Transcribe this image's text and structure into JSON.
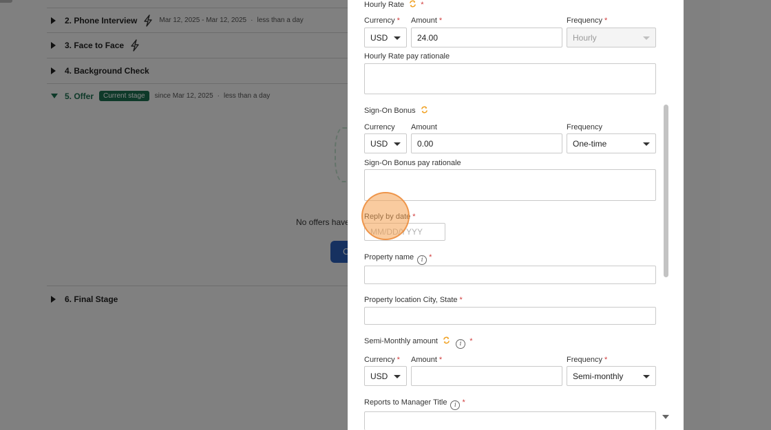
{
  "background": {
    "stages": [
      {
        "title": "2. Phone Interview",
        "dates": "Mar 12, 2025 - Mar 12, 2025",
        "duration": "less than a day"
      },
      {
        "title": "3. Face to Face"
      },
      {
        "title": "4. Background Check"
      },
      {
        "title": "5. Offer",
        "badge": "Current stage",
        "dates": "since Mar 12, 2025",
        "duration": "less than a day"
      },
      {
        "title": "6. Final Stage"
      }
    ],
    "no_offers_text": "No offers have",
    "button_fragment": "C",
    "separator": "·"
  },
  "modal": {
    "hourly_rate": {
      "section_label": "Hourly Rate",
      "currency_label": "Currency",
      "currency_value": "USD",
      "amount_label": "Amount",
      "amount_value": "24.00",
      "frequency_label": "Frequency",
      "frequency_value": "Hourly",
      "rationale_label": "Hourly Rate pay rationale"
    },
    "sign_on_bonus": {
      "section_label": "Sign-On Bonus",
      "currency_label": "Currency",
      "currency_value": "USD",
      "amount_label": "Amount",
      "amount_value": "0.00",
      "frequency_label": "Frequency",
      "frequency_value": "One-time",
      "rationale_label": "Sign-On Bonus pay rationale"
    },
    "reply_by": {
      "label": "Reply by date",
      "placeholder": "MM/DD/YYYY"
    },
    "property_name": {
      "label": "Property name"
    },
    "property_location": {
      "label": "Property location City, State"
    },
    "semi_monthly": {
      "section_label": "Semi-Monthly amount",
      "currency_label": "Currency",
      "currency_value": "USD",
      "amount_label": "Amount",
      "amount_value": "",
      "frequency_label": "Frequency",
      "frequency_value": "Semi-monthly"
    },
    "reports_to": {
      "label": "Reports to Manager Title"
    },
    "required_mark": "*",
    "info_glyph": "i"
  },
  "colors": {
    "accent_green": "#1b6e4f",
    "required_red": "#d03b3b",
    "sync_orange": "#f0a020",
    "click_highlight": "#f4a050"
  },
  "icons": [
    "bolt-icon",
    "sync-icon",
    "info-icon",
    "chevron-down-icon",
    "triangle-right-icon",
    "triangle-down-icon"
  ]
}
